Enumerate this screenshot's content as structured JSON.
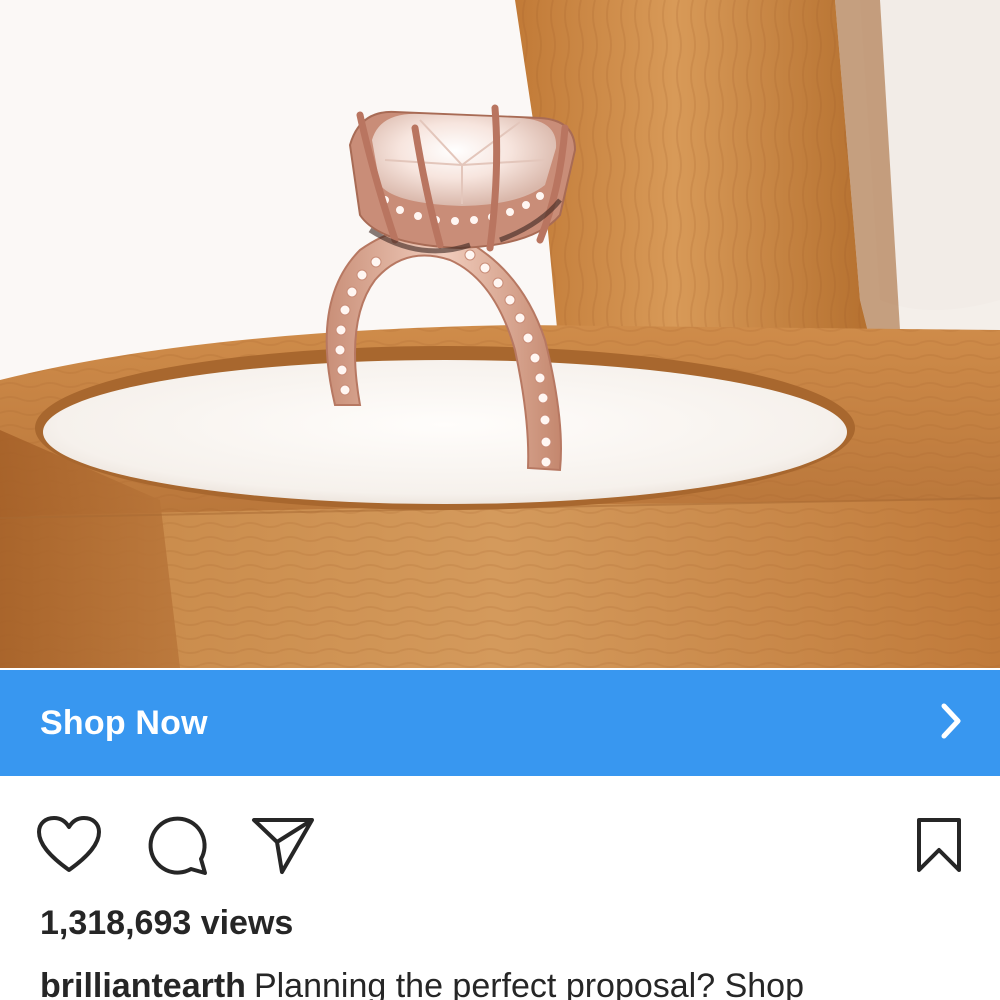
{
  "media": {
    "alt": "rose gold engagement ring in wooden ring box"
  },
  "cta": {
    "label": "Shop Now",
    "icon": "chevron-right-icon",
    "color": "#3897f0"
  },
  "actions": {
    "like_icon": "heart-icon",
    "comment_icon": "comment-icon",
    "share_icon": "paper-plane-icon",
    "save_icon": "bookmark-icon"
  },
  "stats": {
    "views": "1,318,693 views"
  },
  "caption": {
    "username": "brilliantearth",
    "text": "Planning the perfect proposal? Shop"
  }
}
